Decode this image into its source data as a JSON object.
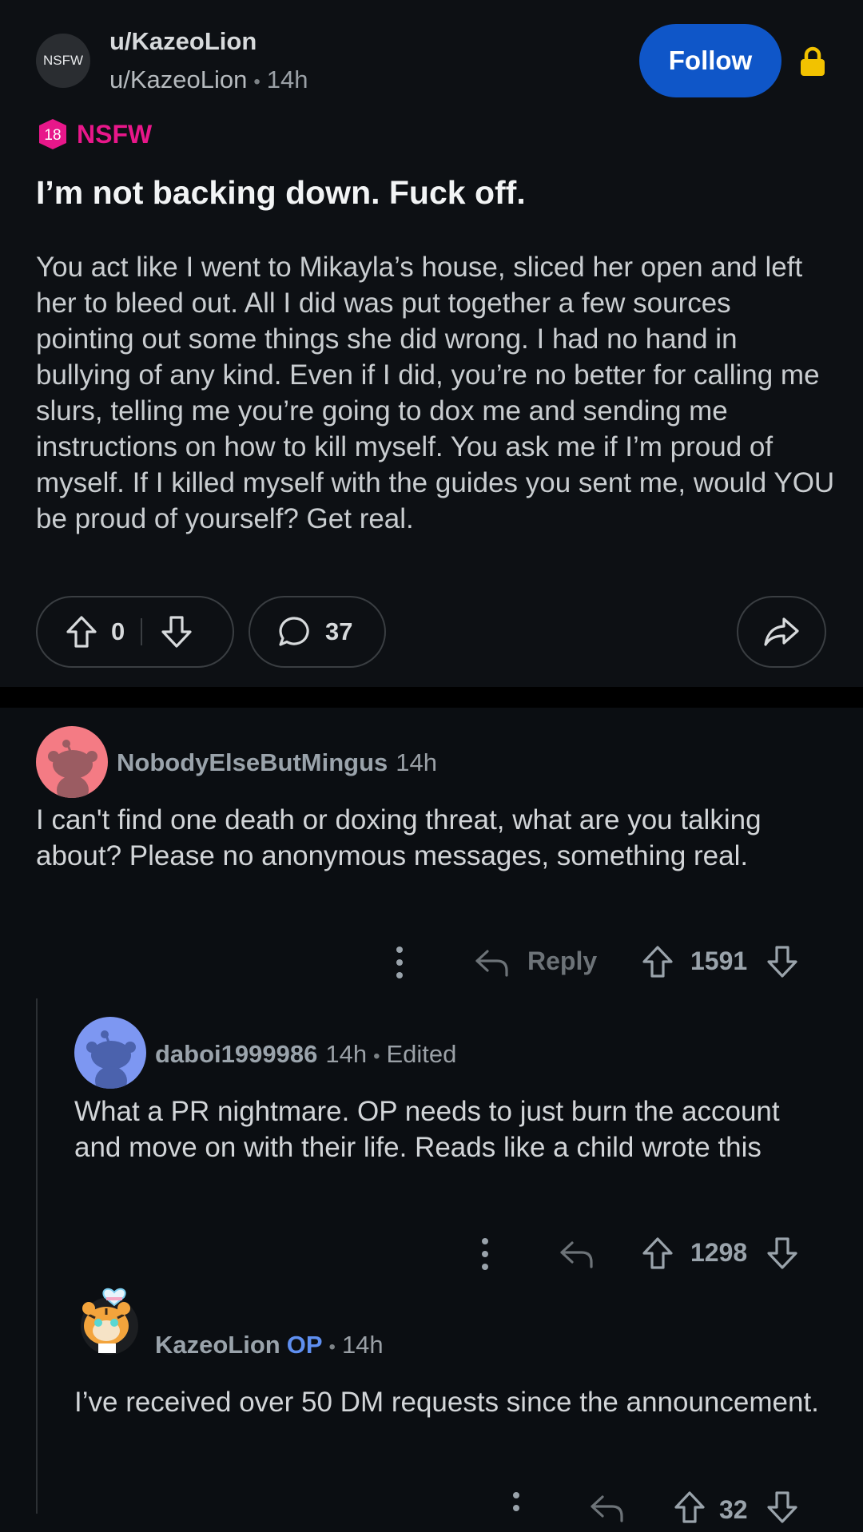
{
  "post": {
    "avatar_text": "NSFW",
    "subreddit": "u/KazeoLion",
    "author": "u/KazeoLion",
    "separator": "•",
    "time": "14h",
    "follow_label": "Follow",
    "nsfw_badge_number": "18",
    "nsfw_label": "NSFW",
    "title": "I’m not backing down. Fuck off.",
    "body": "You act like I went to Mikayla’s house, sliced her open and left her to bleed out. All I did was put together a few sources pointing out some things she did wrong. I had no hand in bullying of any kind. Even if I did, you’re no better for calling me slurs, telling me you’re going to dox me and sending me instructions on how to kill myself. You ask me if I’m proud of myself. If I killed myself with the guides you sent me, would YOU be proud of yourself? Get real.",
    "score": "0",
    "comment_count": "37",
    "icons": {
      "upvote": "upvote-icon",
      "downvote": "downvote-icon",
      "comment": "comment-icon",
      "share": "share-icon",
      "lock": "lock-icon",
      "nsfw": "nsfw-shield-icon"
    },
    "colors": {
      "follow_bg": "#0f56c8",
      "nsfw": "#e8178a",
      "lock": "#f2c200"
    }
  },
  "comments": [
    {
      "author": "NobodyElseButMingus",
      "time": "14h",
      "text": "I can't find one death or doxing threat, what are you talking about? Please no anonymous messages, something real.",
      "reply_label": "Reply",
      "score": "1591",
      "avatar_color": "#f47b84"
    },
    {
      "author": "daboi1999986",
      "time": "14h",
      "separator": "•",
      "edited": "Edited",
      "text": "What a PR nightmare. OP needs to just burn the account and move on with their life. Reads like a child wrote this",
      "score": "1298",
      "avatar_color": "#7d97f2"
    },
    {
      "author": "KazeoLion",
      "op_label": "OP",
      "separator": "•",
      "time": "14h",
      "text": "I’ve received over 50 DM requests since the announcement.",
      "score": "32"
    }
  ]
}
